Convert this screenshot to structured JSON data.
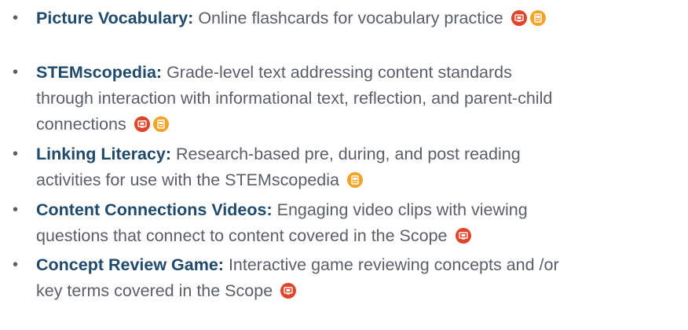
{
  "colors": {
    "term": "#1f4a6b",
    "body_text": "#5a5f66",
    "digital_icon": "#e0452c",
    "print_icon": "#f2a427"
  },
  "bullet": "•",
  "items": [
    {
      "term": "Picture Vocabulary:",
      "line1": " Online flashcards for vocabulary practice",
      "line2": "",
      "line3": "",
      "icons": [
        "digital-resource-icon",
        "printable-resource-icon"
      ]
    },
    {
      "term": "STEMscopedia:",
      "line1": " Grade-level text addressing content standards",
      "line2": "through interaction with informational text, reflection, and parent-child",
      "line3": "connections",
      "icons": [
        "digital-resource-icon",
        "printable-resource-icon"
      ]
    },
    {
      "term": "Linking Literacy:",
      "line1": " Research-based pre, during, and post reading",
      "line2": "activities for use with the STEMscopedia",
      "line3": "",
      "icons": [
        "printable-resource-icon"
      ]
    },
    {
      "term": "Content Connections Videos:",
      "line1": " Engaging video clips with viewing",
      "line2": "questions that connect to content covered in the Scope",
      "line3": "",
      "icons": [
        "digital-resource-icon"
      ]
    },
    {
      "term": "Concept Review Game:",
      "line1": " Interactive game reviewing concepts and /or",
      "line2": "key terms covered in the Scope",
      "line3": "",
      "icons": [
        "digital-resource-icon"
      ]
    }
  ]
}
